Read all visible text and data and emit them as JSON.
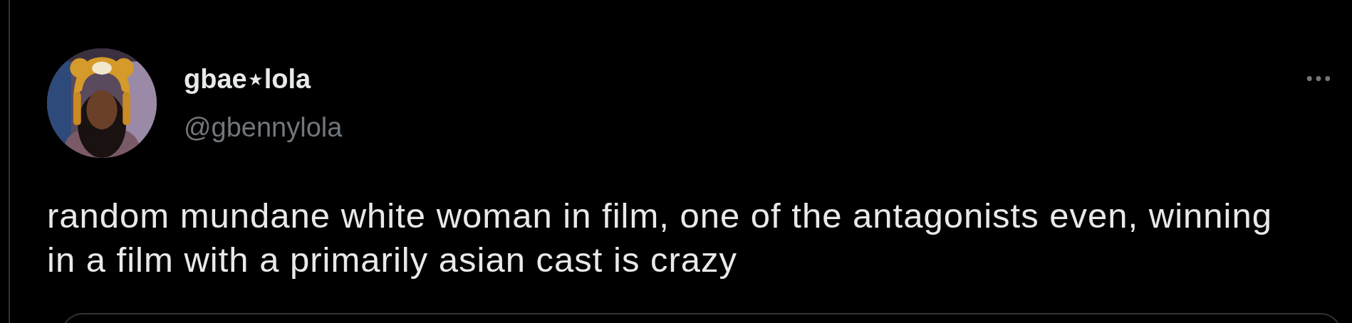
{
  "tweet": {
    "author": {
      "display_name": "gbae⋆lola",
      "handle": "@gbennylola"
    },
    "text": "random mundane white woman in film, one of the antagonists even, winning in a film with a primarily asian cast is crazy",
    "has_quote_card": true
  }
}
